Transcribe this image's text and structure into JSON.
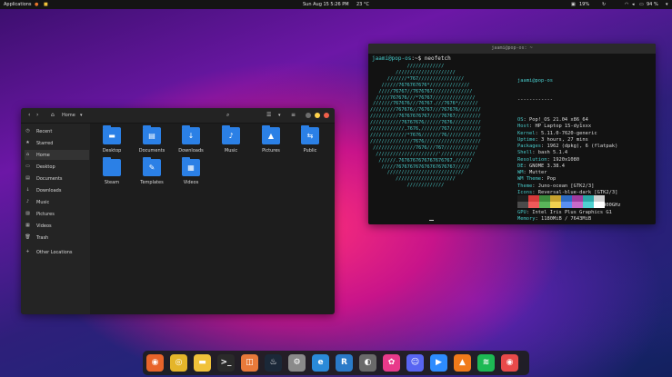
{
  "topbar": {
    "applications": "Applications",
    "clock": "Sun Aug 15   5:26 PM",
    "weather": "23 °C",
    "battery1": "19%",
    "battery2": "94 %"
  },
  "file_manager": {
    "location": "Home",
    "sidebar": [
      {
        "label": "Recent",
        "icon": "clock-icon"
      },
      {
        "label": "Starred",
        "icon": "star-icon"
      },
      {
        "label": "Home",
        "icon": "home-icon"
      },
      {
        "label": "Desktop",
        "icon": "desktop-icon"
      },
      {
        "label": "Documents",
        "icon": "document-icon"
      },
      {
        "label": "Downloads",
        "icon": "download-icon"
      },
      {
        "label": "Music",
        "icon": "music-icon"
      },
      {
        "label": "Pictures",
        "icon": "picture-icon"
      },
      {
        "label": "Videos",
        "icon": "video-icon"
      },
      {
        "label": "Trash",
        "icon": "trash-icon"
      },
      {
        "label": "Other Locations",
        "icon": "plus-icon"
      }
    ],
    "folders": [
      {
        "label": "Desktop",
        "glyph": "▬"
      },
      {
        "label": "Documents",
        "glyph": "▤"
      },
      {
        "label": "Downloads",
        "glyph": "↓"
      },
      {
        "label": "Music",
        "glyph": "♪"
      },
      {
        "label": "Pictures",
        "glyph": "▲"
      },
      {
        "label": "Public",
        "glyph": "⇆"
      },
      {
        "label": "Steam",
        "glyph": ""
      },
      {
        "label": "Templates",
        "glyph": "✎"
      },
      {
        "label": "Videos",
        "glyph": "▦"
      }
    ]
  },
  "terminal": {
    "title": "jaami@pop-os: ~",
    "prompt_user": "jaami@pop-os",
    "prompt_rest": ":~$ neofetch",
    "logo": "             /////////////\n         /////////////////////\n      ///////*767////////////////\n    //////7676767676*//////////////\n   /////76767//7676767//////////////\n  /////767676///*76767///////////////\n ///////767676///76767.///7676*///////\n/////////767676//76767///767676////////\n//////////76767676767////76767/////////\n///////////76767676//////7676//////////\n////////////,7676,///////767///////////\n/////////////*7676///////76////////////\n///////////////7676////////////////////\n ///////////////7676///767////////////\n  //////////////////////'////////////\n   //////.7676767676767676767,//////\n    /////767676767676767676767/////\n      ///////////////////////////\n         /////////////////////\n             /////////////",
    "user_host": "jaami@pop-os",
    "separator": "------------",
    "info": [
      {
        "key": "OS",
        "value": "Pop!_OS 21.04 x86_64"
      },
      {
        "key": "Host",
        "value": "HP Laptop 15-dy1xxx"
      },
      {
        "key": "Kernel",
        "value": "5.11.0-7620-generic"
      },
      {
        "key": "Uptime",
        "value": "3 hours, 27 mins"
      },
      {
        "key": "Packages",
        "value": "1962 (dpkg), 6 (flatpak)"
      },
      {
        "key": "Shell",
        "value": "bash 5.1.4"
      },
      {
        "key": "Resolution",
        "value": "1920x1080"
      },
      {
        "key": "DE",
        "value": "GNOME 3.38.4"
      },
      {
        "key": "WM",
        "value": "Mutter"
      },
      {
        "key": "WM Theme",
        "value": "Pop"
      },
      {
        "key": "Theme",
        "value": "Juno-ocean [GTK2/3]"
      },
      {
        "key": "Icons",
        "value": "Reversal-blue-dark [GTK2/3]"
      },
      {
        "key": "Terminal",
        "value": "gnome-terminal"
      },
      {
        "key": "CPU",
        "value": "Intel i3-1005G1 (4) @ 3.400GHz"
      },
      {
        "key": "GPU",
        "value": "Intel Iris Plus Graphics G1"
      },
      {
        "key": "Memory",
        "value": "1180MiB / 7643MiB"
      }
    ],
    "palette_top": [
      "#1e1e1e",
      "#d53a3a",
      "#3c8c3c",
      "#c8a22e",
      "#2e6bc0",
      "#a03ca0",
      "#2aa6a6",
      "#d0d0d0"
    ],
    "palette_bottom": [
      "#4a4a4a",
      "#f05a5a",
      "#5ab45a",
      "#f0d050",
      "#5a8ff0",
      "#c86ac8",
      "#50d0d0",
      "#ffffff"
    ]
  },
  "dock": [
    {
      "name": "firefox",
      "color": "#e8642a",
      "glyph": "◉"
    },
    {
      "name": "chrome",
      "color": "#e4b52a",
      "glyph": "◎"
    },
    {
      "name": "files",
      "color": "#f0c23a",
      "glyph": "▬"
    },
    {
      "name": "terminal",
      "color": "#2a2a2a",
      "glyph": ">_"
    },
    {
      "name": "store",
      "color": "#e87a3a",
      "glyph": "◫"
    },
    {
      "name": "steam",
      "color": "#1b2838",
      "glyph": "♨"
    },
    {
      "name": "settings",
      "color": "#8a8a8a",
      "glyph": "⚙"
    },
    {
      "name": "edge",
      "color": "#2a8ad8",
      "glyph": "e"
    },
    {
      "name": "reader",
      "color": "#2a7ac8",
      "glyph": "R"
    },
    {
      "name": "toggle",
      "color": "#6a6a6a",
      "glyph": "◐"
    },
    {
      "name": "color-picker",
      "color": "#e83a8a",
      "glyph": "✿"
    },
    {
      "name": "discord",
      "color": "#5865f2",
      "glyph": "☺"
    },
    {
      "name": "zoom",
      "color": "#2d8cff",
      "glyph": "▶"
    },
    {
      "name": "vlc",
      "color": "#f07a1a",
      "glyph": "▲"
    },
    {
      "name": "spotify",
      "color": "#1db954",
      "glyph": "≋"
    },
    {
      "name": "screen-recorder",
      "color": "#e84a4a",
      "glyph": "◉"
    }
  ]
}
